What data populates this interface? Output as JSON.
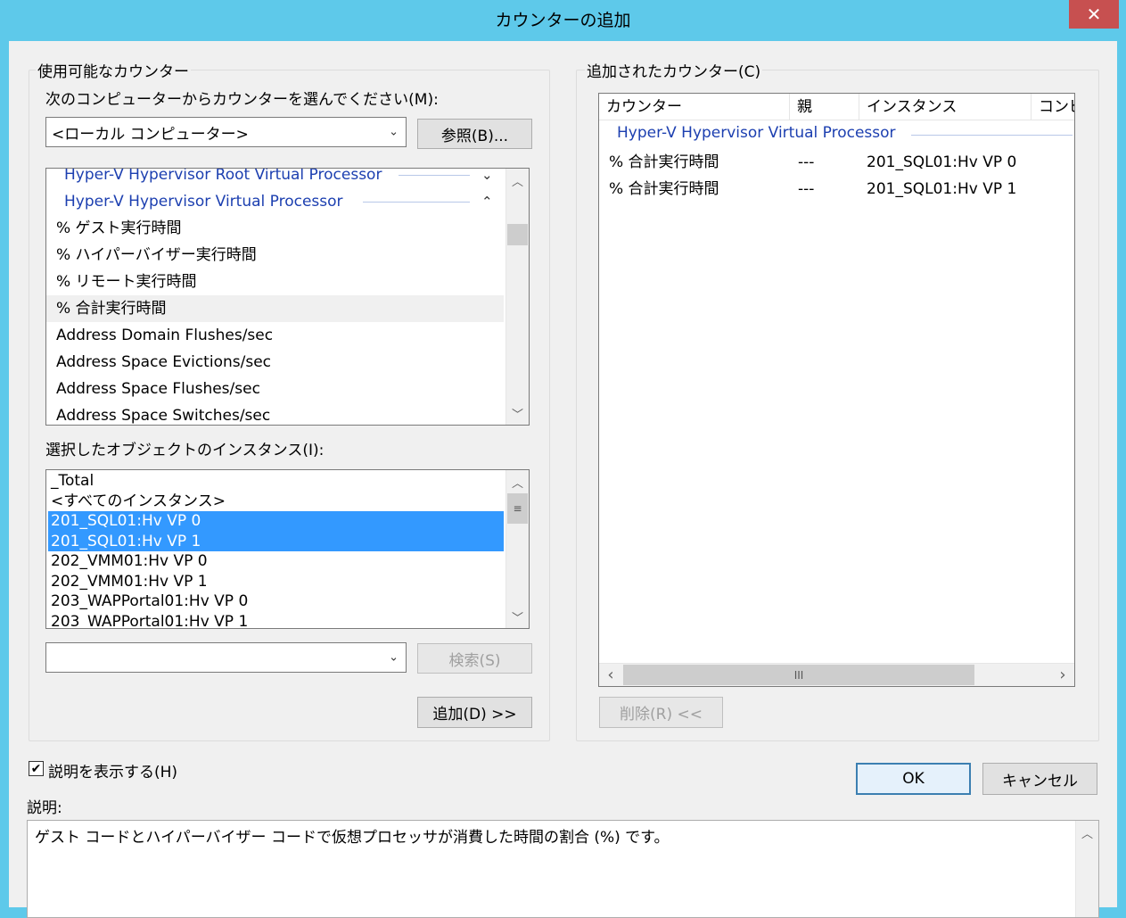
{
  "window": {
    "title": "カウンターの追加",
    "close_label": "✕"
  },
  "available": {
    "group_label": "使用可能なカウンター",
    "computer_prompt": "次のコンピューターからカウンターを選んでください(M):",
    "computer_value": "<ローカル コンピューター>",
    "browse_label": "参照(B)...",
    "counters": [
      {
        "text": "Hyper-V Hypervisor Root Virtual Processor",
        "kind": "object",
        "chevron": "⌄"
      },
      {
        "text": "Hyper-V Hypervisor Virtual Processor",
        "kind": "object",
        "chevron": "⌃"
      },
      {
        "text": "% ゲスト実行時間",
        "kind": "counter"
      },
      {
        "text": "% ハイパーバイザー実行時間",
        "kind": "counter"
      },
      {
        "text": "% リモート実行時間",
        "kind": "counter"
      },
      {
        "text": "% 合計実行時間",
        "kind": "counter",
        "state": "hover"
      },
      {
        "text": "Address Domain Flushes/sec",
        "kind": "counter"
      },
      {
        "text": "Address Space Evictions/sec",
        "kind": "counter"
      },
      {
        "text": "Address Space Flushes/sec",
        "kind": "counter"
      },
      {
        "text": "Address Space Switches/sec",
        "kind": "counter"
      }
    ],
    "instances_label": "選択したオブジェクトのインスタンス(I):",
    "instances": [
      {
        "text": "_Total"
      },
      {
        "text": "<すべてのインスタンス>"
      },
      {
        "text": "201_SQL01:Hv VP 0",
        "selected": true
      },
      {
        "text": "201_SQL01:Hv VP 1",
        "selected": true
      },
      {
        "text": "202_VMM01:Hv VP 0"
      },
      {
        "text": "202_VMM01:Hv VP 1"
      },
      {
        "text": "203_WAPPortal01:Hv VP 0"
      },
      {
        "text": "203_WAPPortal01:Hv VP 1"
      }
    ],
    "search_value": "",
    "search_label": "検索(S)",
    "add_label": "追加(D) >>"
  },
  "added": {
    "group_label": "追加されたカウンター(C)",
    "columns": [
      "カウンター",
      "親",
      "インスタンス",
      "コンピ"
    ],
    "object_name": "Hyper-V Hypervisor Virtual Processor",
    "rows": [
      {
        "counter": "% 合計実行時間",
        "parent": "---",
        "instance": "201_SQL01:Hv VP 0"
      },
      {
        "counter": "% 合計実行時間",
        "parent": "---",
        "instance": "201_SQL01:Hv VP 1"
      }
    ],
    "hscroll_grip": "III",
    "remove_label": "削除(R) <<"
  },
  "footer": {
    "show_description_label": "説明を表示する(H)",
    "show_description_checked": true,
    "check_mark": "✔",
    "ok_label": "OK",
    "cancel_label": "キャンセル",
    "description_label": "説明:",
    "description_text": "ゲスト コードとハイパーバイザー コードで仮想プロセッサが消費した時間の割合 (%) です。"
  },
  "icons": {
    "chevron_down": "⌄",
    "scroll_up": "︿",
    "scroll_down": "﹀",
    "scroll_left": "‹",
    "scroll_right": "›",
    "grip": "≡"
  }
}
